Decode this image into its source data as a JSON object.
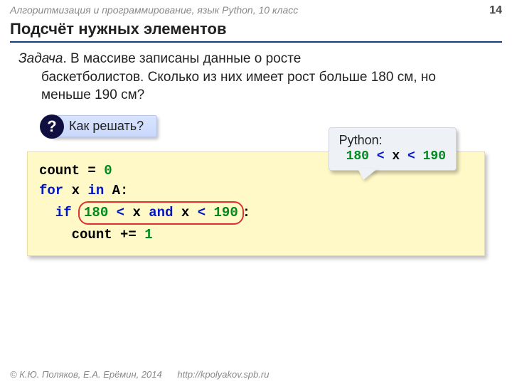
{
  "header": {
    "course": "Алгоритмизация и программирование, язык Python, 10 класс",
    "page": "14"
  },
  "title": "Подсчёт нужных элементов",
  "task": {
    "label": "Задача",
    "text_line1": ". В массиве записаны данные о росте",
    "text_line2": "баскетболистов. Сколько из них имеет рост больше 180 см, но меньше 190 см?"
  },
  "question": {
    "mark": "?",
    "text": "Как решать?"
  },
  "code": {
    "l1_a": "count",
    "l1_eq": "=",
    "l1_zero": "0",
    "l2_for": "for",
    "l2_x": " x ",
    "l2_in": "in",
    "l2_A": " A:",
    "l3_if": "  if ",
    "l3_180": "180",
    "l3_lt1": " <",
    "l3_x": " x ",
    "l3_and": "and",
    "l3_x2": " x",
    "l3_lt2": " <",
    "l3_190": "190",
    "l3_colon": ":",
    "l4": "    count",
    "l4_pluseq": "+=",
    "l4_one": "1"
  },
  "callout": {
    "label": "Python:",
    "n1": "180",
    "op1": " < ",
    "x": "x",
    "op2": " < ",
    "n2": "190"
  },
  "footer": {
    "copyright": "© К.Ю. Поляков, Е.А. Ерёмин, 2014",
    "url": "http://kpolyakov.spb.ru"
  }
}
